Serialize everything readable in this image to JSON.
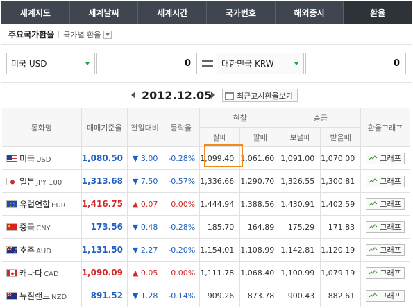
{
  "tabs": [
    {
      "label": "세계지도"
    },
    {
      "label": "세계날씨"
    },
    {
      "label": "세계시간"
    },
    {
      "label": "국가번호"
    },
    {
      "label": "해외증시"
    },
    {
      "label": "환율",
      "active": true
    }
  ],
  "title": {
    "main": "주요국가환율",
    "sub": "국가별 환율"
  },
  "converter": {
    "from_currency": "미국 USD",
    "from_amount": "0",
    "to_currency": "대한민국 KRW",
    "to_amount": "0"
  },
  "date_nav": {
    "date": "2012.12.05",
    "recent_button": "최근고시환율보기"
  },
  "table": {
    "headers": {
      "currency": "통화명",
      "base_rate": "매매기준율",
      "change": "전일대비",
      "change_pct": "등락율",
      "cash": "현찰",
      "cash_buy": "살때",
      "cash_sell": "팔때",
      "transfer": "송금",
      "transfer_send": "보낼때",
      "transfer_receive": "받을때",
      "graph": "환율그래프"
    },
    "rows": [
      {
        "flag": "us",
        "name": "미국",
        "code": "USD",
        "base": "1,080.50",
        "direction": "down",
        "arrow": "▼",
        "change": "3.00",
        "pct": "-0.28%",
        "cash_buy": "1,099.40",
        "cash_sell": "1,061.60",
        "send": "1,091.00",
        "receive": "1,070.00",
        "graph": "그래프"
      },
      {
        "flag": "jp",
        "name": "일본",
        "code": "JPY 100",
        "base": "1,313.68",
        "direction": "down",
        "arrow": "▼",
        "change": "7.50",
        "pct": "-0.57%",
        "cash_buy": "1,336.66",
        "cash_sell": "1,290.70",
        "send": "1,326.55",
        "receive": "1,300.81",
        "graph": "그래프"
      },
      {
        "flag": "eu",
        "name": "유럽연합",
        "code": "EUR",
        "base": "1,416.75",
        "direction": "up",
        "arrow": "▲",
        "change": "0.07",
        "pct": "0.00%",
        "cash_buy": "1,444.94",
        "cash_sell": "1,388.56",
        "send": "1,430.91",
        "receive": "1,402.59",
        "graph": "그래프"
      },
      {
        "flag": "cn",
        "name": "중국",
        "code": "CNY",
        "base": "173.56",
        "direction": "down",
        "arrow": "▼",
        "change": "0.48",
        "pct": "-0.28%",
        "cash_buy": "185.70",
        "cash_sell": "164.89",
        "send": "175.29",
        "receive": "171.83",
        "graph": "그래프"
      },
      {
        "flag": "au",
        "name": "호주",
        "code": "AUD",
        "base": "1,131.50",
        "direction": "down",
        "arrow": "▼",
        "change": "2.27",
        "pct": "-0.20%",
        "cash_buy": "1,154.01",
        "cash_sell": "1,108.99",
        "send": "1,142.81",
        "receive": "1,120.19",
        "graph": "그래프"
      },
      {
        "flag": "ca",
        "name": "캐나다",
        "code": "CAD",
        "base": "1,090.09",
        "direction": "up",
        "arrow": "▲",
        "change": "0.05",
        "pct": "0.00%",
        "cash_buy": "1,111.78",
        "cash_sell": "1,068.40",
        "send": "1,100.99",
        "receive": "1,079.19",
        "graph": "그래프"
      },
      {
        "flag": "nz",
        "name": "뉴질랜드",
        "code": "NZD",
        "base": "891.52",
        "direction": "down",
        "arrow": "▼",
        "change": "1.28",
        "pct": "-0.14%",
        "cash_buy": "909.26",
        "cash_sell": "873.78",
        "send": "900.43",
        "receive": "882.61",
        "graph": "그래프"
      }
    ]
  },
  "colors": {
    "tab_bar": "#3f4650",
    "up": "#d12a2a",
    "down": "#1f5fc2",
    "highlight": "#f08a1c"
  }
}
